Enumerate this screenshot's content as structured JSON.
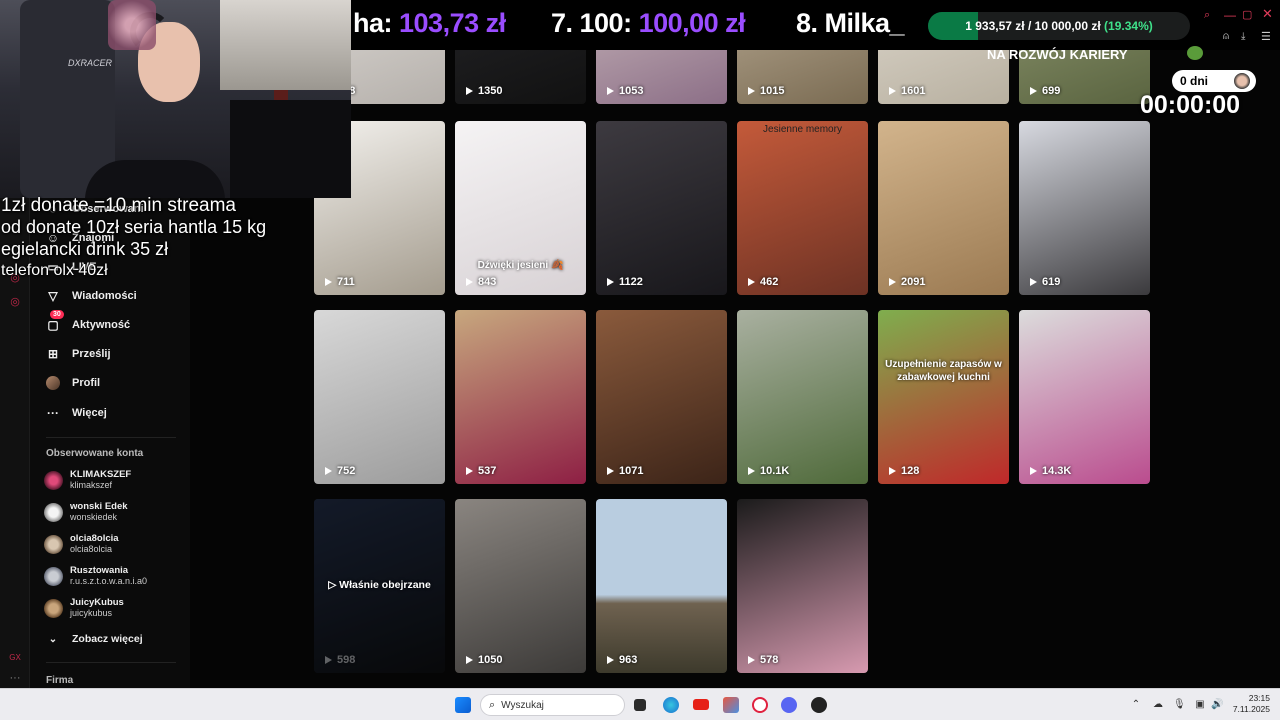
{
  "stream": {
    "ticker_segments": [
      {
        "prefix": "ha: ",
        "amount": "103,73 zł"
      },
      {
        "prefix": "7. 100: ",
        "amount": "100,00 zł"
      },
      {
        "prefix": "8. Milka_",
        "amount": ""
      }
    ],
    "goal": {
      "current": "1 933,57 zł",
      "separator": " / ",
      "target": "10 000,00 zł",
      "percent": "(19.34%)",
      "fraction": 0.1934
    },
    "goal_caption": "NA ROZWÓJ KARIERY",
    "timer_days": "0 dni",
    "timer": "00:00:00",
    "overlay_lines": [
      "1zł donate =10 min streama",
      "od donate 10zł seria hantla 15 kg",
      "egielancki drink 35 zł",
      "telefon olx 40zł"
    ]
  },
  "sidebar": {
    "partial_items": [
      "Obserwowani",
      "Znajomi",
      "LIVE"
    ],
    "nav": [
      {
        "label": "Wiadomości",
        "icon": "messages-icon"
      },
      {
        "label": "Aktywność",
        "icon": "activity-icon",
        "badge": "30"
      },
      {
        "label": "Prześlij",
        "icon": "upload-icon"
      },
      {
        "label": "Profil",
        "icon": "profile-avatar"
      },
      {
        "label": "Więcej",
        "icon": "more-icon"
      }
    ],
    "followed_title": "Obserwowane konta",
    "accounts": [
      {
        "name": "KLIMAKSZEF",
        "user": "klimakszef"
      },
      {
        "name": "wonski Edek",
        "user": "wonskiedek"
      },
      {
        "name": "olcia8olcia",
        "user": "olcia8olcia"
      },
      {
        "name": "Rusztowania",
        "user": "r.u.s.z.t.o.w.a.n.i.a0"
      },
      {
        "name": "JuicyKubus",
        "user": "juicykubus"
      }
    ],
    "see_more": "Zobacz więcej",
    "company": "Firma"
  },
  "videos": [
    {
      "views": "158",
      "row": 0
    },
    {
      "views": "1350",
      "row": 0
    },
    {
      "views": "1053",
      "row": 0
    },
    {
      "views": "1015",
      "row": 0
    },
    {
      "views": "1601",
      "row": 0
    },
    {
      "views": "699",
      "row": 0
    },
    {
      "views": "711",
      "row": 1
    },
    {
      "views": "843",
      "row": 1,
      "caption": "Dźwięki jesieni 🍂"
    },
    {
      "views": "1122",
      "row": 1
    },
    {
      "views": "462",
      "row": 1,
      "caption": "Jesienne memory"
    },
    {
      "views": "2091",
      "row": 1
    },
    {
      "views": "619",
      "row": 1
    },
    {
      "views": "752",
      "row": 2
    },
    {
      "views": "537",
      "row": 2
    },
    {
      "views": "1071",
      "row": 2
    },
    {
      "views": "10.1K",
      "row": 2
    },
    {
      "views": "128",
      "row": 2,
      "caption": "Uzupełnienie zapasów w zabawkowej kuchni"
    },
    {
      "views": "14.3K",
      "row": 2
    },
    {
      "views": "598",
      "row": 3,
      "watched": "Właśnie obejrzane"
    },
    {
      "views": "1050",
      "row": 3
    },
    {
      "views": "963",
      "row": 3
    },
    {
      "views": "578",
      "row": 3
    }
  ],
  "taskbar": {
    "search_placeholder": "Wyszukaj",
    "time": "23:15",
    "date": "7.11.2025"
  }
}
